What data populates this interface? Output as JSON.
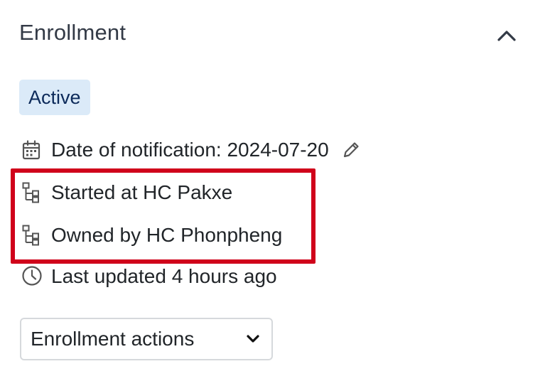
{
  "section": {
    "title": "Enrollment",
    "collapse_icon": "chevron-up-icon"
  },
  "status_badge": {
    "label": "Active",
    "bg_color": "#dbeaf8",
    "text_color": "#0c2a5a"
  },
  "details": {
    "date_label": "Date of notification: 2024-07-20",
    "date_icon": "calendar-icon",
    "edit_icon": "pencil-icon",
    "started_label": "Started at HC Pakxe",
    "started_icon": "org-hierarchy-icon",
    "owned_label": "Owned by HC Phonpheng",
    "owned_icon": "org-hierarchy-icon",
    "updated_label": "Last updated 4 hours ago",
    "updated_icon": "clock-icon"
  },
  "highlight": {
    "color": "#d0021b"
  },
  "actions": {
    "label": "Enrollment actions",
    "icon": "chevron-down-icon"
  }
}
